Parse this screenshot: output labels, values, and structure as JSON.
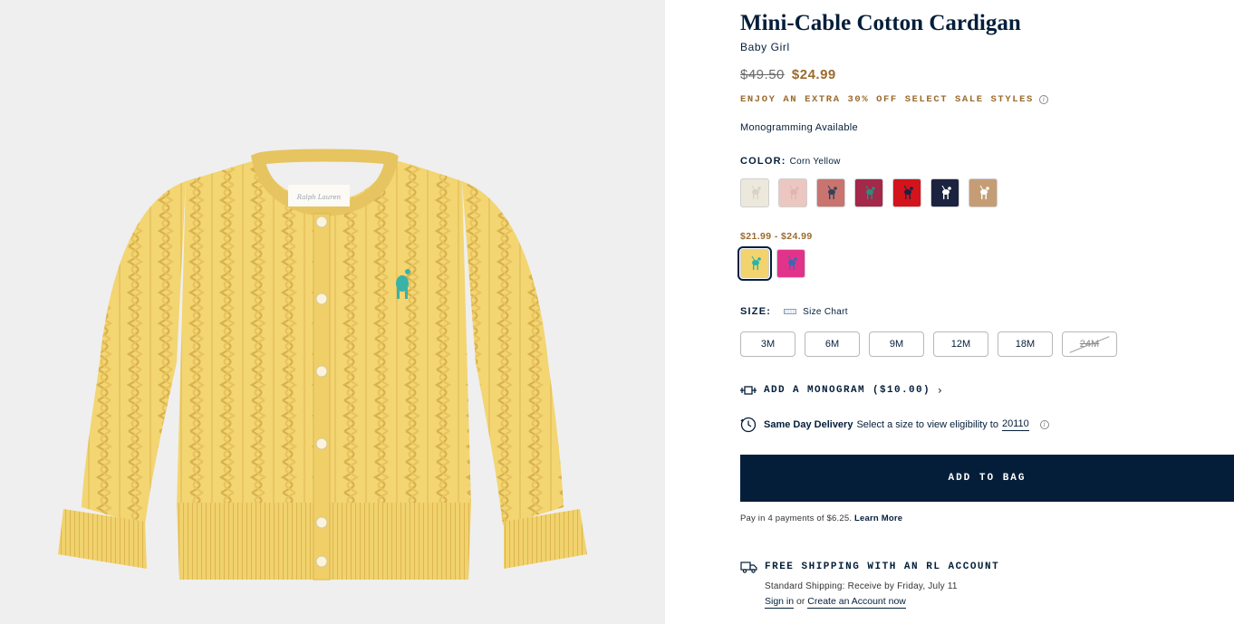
{
  "product": {
    "title": "Mini-Cable Cotton Cardigan",
    "subtitle": "Baby Girl",
    "price_original": "$49.50",
    "price_sale": "$24.99",
    "promo": "ENJOY AN EXTRA 30% OFF SELECT SALE STYLES",
    "monogram_note": "Monogramming Available"
  },
  "color": {
    "label": "COLOR:",
    "selected_name": "Corn Yellow",
    "swatches": [
      {
        "name": "cream",
        "bg": "#ece9dc",
        "pony": "#d9d3c4"
      },
      {
        "name": "light-pink",
        "bg": "#ecc7c2",
        "pony": "#e3b5ae"
      },
      {
        "name": "rose",
        "bg": "#c9746f",
        "pony": "#33415c"
      },
      {
        "name": "berry",
        "bg": "#a3284a",
        "pony": "#2c8d7a"
      },
      {
        "name": "red",
        "bg": "#d3141c",
        "pony": "#1c2340"
      },
      {
        "name": "navy",
        "bg": "#1c2340",
        "pony": "#ffffff"
      },
      {
        "name": "camel",
        "bg": "#c59d75",
        "pony": "#ffffff"
      }
    ],
    "price_range": "$21.99 - $24.99",
    "swatches_sale": [
      {
        "name": "corn-yellow",
        "bg": "#f2d36d",
        "pony": "#2bb3a4"
      },
      {
        "name": "hot-pink",
        "bg": "#e2338b",
        "pony": "#3b66b3"
      }
    ]
  },
  "size": {
    "label": "SIZE:",
    "chart_label": "Size Chart",
    "options": [
      {
        "label": "3M",
        "available": true
      },
      {
        "label": "6M",
        "available": true
      },
      {
        "label": "9M",
        "available": true
      },
      {
        "label": "12M",
        "available": true
      },
      {
        "label": "18M",
        "available": true
      },
      {
        "label": "24M",
        "available": false
      }
    ]
  },
  "monogram": {
    "label": "ADD A MONOGRAM ($10.00)"
  },
  "delivery": {
    "title": "Same Day Delivery",
    "text": "Select a size to view eligibility to",
    "zip": "20110"
  },
  "cart": {
    "add_label": "ADD TO BAG",
    "installments_text": "Pay in 4 payments of $6.25.",
    "learn_more": "Learn More"
  },
  "shipping": {
    "title": "FREE SHIPPING WITH AN RL ACCOUNT",
    "detail": "Standard Shipping: Receive by Friday, July 11",
    "sign_in": "Sign in",
    "or": "or",
    "create": "Create an Account",
    "now": "now"
  },
  "colors": {
    "navy": "#041e3a",
    "gold": "#9a6b2f",
    "gallery_bg": "#efefef",
    "cardigan": "#f3d572"
  }
}
